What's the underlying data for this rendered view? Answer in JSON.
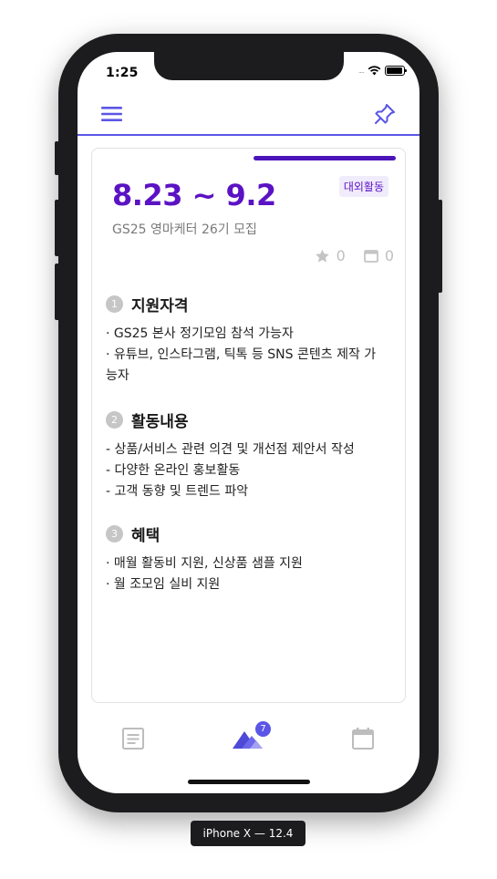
{
  "status_bar": {
    "time": "1:25",
    "signal": "....",
    "wifi_icon": "wifi-icon",
    "battery_icon": "battery-icon"
  },
  "topbar": {
    "menu_icon": "hamburger-menu-icon",
    "pin_icon": "pin-icon",
    "accent_color": "#5b56e6"
  },
  "card": {
    "date_range": "8.23 ~ 9.2",
    "category": "대외활동",
    "subtitle": "GS25 영마케터 26기 모집",
    "star_count": "0",
    "calendar_count": "0",
    "accent_color": "#5b12c4",
    "sections": [
      {
        "number": "1",
        "title": "지원자격",
        "lines": [
          "· GS25 본사 정기모임 참석 가능자",
          "· 유튜브, 인스타그램, 틱톡 등 SNS 콘텐츠 제작 가능자"
        ]
      },
      {
        "number": "2",
        "title": "활동내용",
        "lines": [
          " - 상품/서비스 관련 의견 및 개선점 제안서 작성",
          " - 다양한 온라인 홍보활동",
          " - 고객 동향 및 트렌드 파악"
        ]
      },
      {
        "number": "3",
        "title": "혜택",
        "lines": [
          "· 매월 활동비 지원, 신상품 샘플 지원",
          "· 월 조모임 실비 지원"
        ]
      }
    ]
  },
  "tabbar": {
    "badge_count": "7",
    "tabs": [
      "list-icon",
      "home-icon",
      "calendar-icon"
    ]
  },
  "device_label": "iPhone X — 12.4"
}
